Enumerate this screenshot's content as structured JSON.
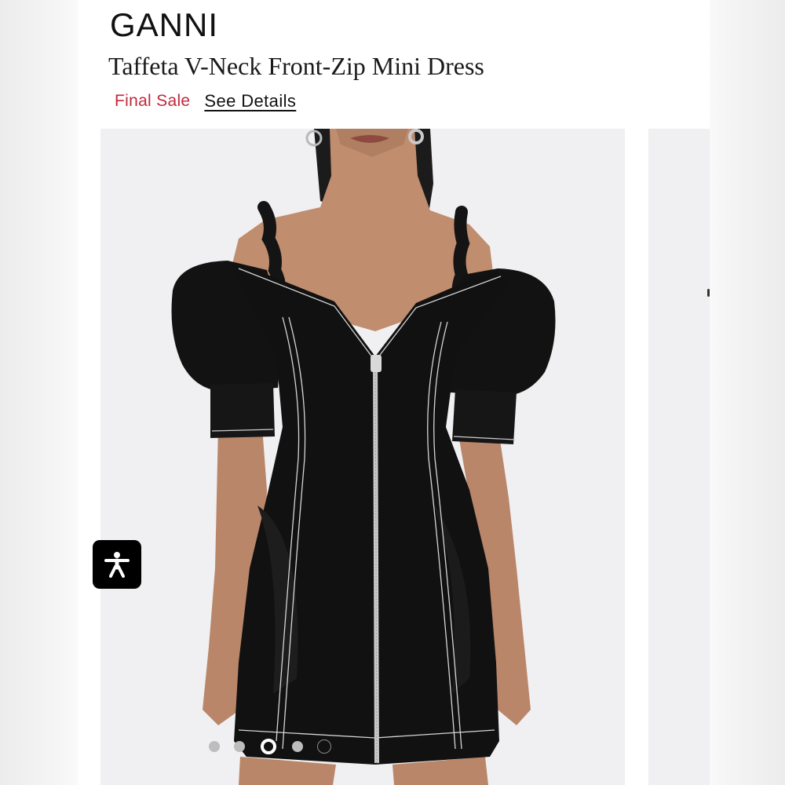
{
  "brand": "GANNI",
  "product": {
    "title": "Taffeta V-Neck Front-Zip Mini Dress",
    "final_sale_label": "Final Sale",
    "see_details_label": "See Details"
  },
  "gallery": {
    "image_count": 5,
    "active_index": 2,
    "image_alt": "Black taffeta off-shoulder mini dress with puff sleeves, contrast white topstitching and front zip"
  },
  "accessibility_button": {
    "icon": "accessibility-person-icon"
  },
  "colors": {
    "sale_red": "#c2283a",
    "link_black": "#111111",
    "image_bg": "#f0eff1"
  }
}
